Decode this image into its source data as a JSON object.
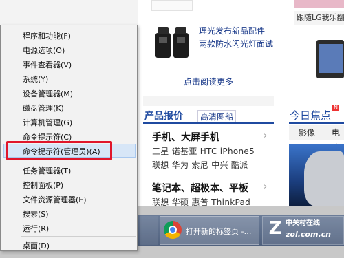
{
  "webpage": {
    "top_snippet": "…",
    "banner_label": "跟随LG我乐翻",
    "product_title": "理光发布新品配件 两款防水闪光灯面试",
    "read_more": "点击阅读更多",
    "price_section_title": "产品报价",
    "price_section_link": "高清图船",
    "categories": [
      {
        "head": "手机、大屏手机",
        "items": [
          "三星 诺基亚 HTC iPhone5",
          "联想 华为 索尼 中兴 酷派"
        ]
      },
      {
        "head": "笔记本、超极本、平板",
        "items": [
          "联想 华硕 惠普 ThinkPad"
        ]
      }
    ],
    "focus_title": "今日焦点",
    "focus_badge": "N",
    "focus_tabs": [
      "影像",
      "电脑"
    ]
  },
  "winx_menu": {
    "items": [
      {
        "label": "程序和功能(F)"
      },
      {
        "label": "电源选项(O)"
      },
      {
        "label": "事件查看器(V)"
      },
      {
        "label": "系统(Y)"
      },
      {
        "label": "设备管理器(M)"
      },
      {
        "label": "磁盘管理(K)"
      },
      {
        "label": "计算机管理(G)"
      },
      {
        "label": "命令提示符(C)"
      },
      {
        "label": "命令提示符(管理员)(A)",
        "highlighted": true
      },
      {
        "label": "任务管理器(T)"
      },
      {
        "label": "控制面板(P)"
      },
      {
        "label": "文件资源管理器(E)"
      },
      {
        "label": "搜索(S)"
      },
      {
        "label": "运行(R)"
      },
      {
        "label": "桌面(D)"
      }
    ],
    "highlight_color": "#d7e6f7",
    "callout_color": "#e0162b"
  },
  "taskbar": {
    "chrome_task_label": "打开新的标签页 -…",
    "second_task_label": "…",
    "watermark_line1": "中关村在线",
    "watermark_line2": "zol.com.cn"
  }
}
